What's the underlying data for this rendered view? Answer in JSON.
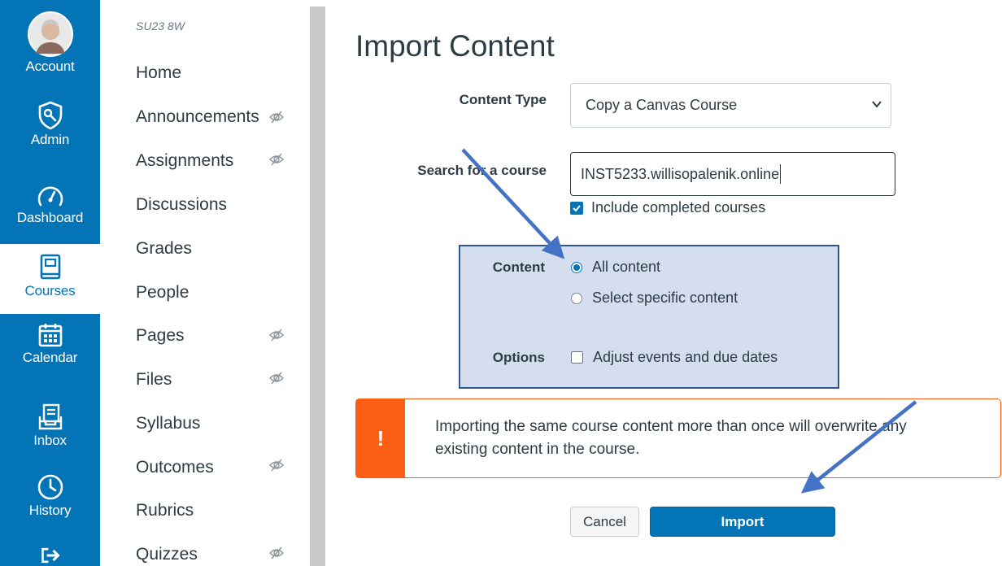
{
  "global_nav": {
    "items": [
      {
        "label": "Account",
        "icon": "avatar"
      },
      {
        "label": "Admin",
        "icon": "shield-icon"
      },
      {
        "label": "Dashboard",
        "icon": "speedometer-icon"
      },
      {
        "label": "Courses",
        "icon": "book-icon"
      },
      {
        "label": "Calendar",
        "icon": "calendar-icon"
      },
      {
        "label": "Inbox",
        "icon": "inbox-icon"
      },
      {
        "label": "History",
        "icon": "clock-icon"
      },
      {
        "label": "",
        "icon": "logout-icon"
      }
    ],
    "active": "Courses",
    "colors": {
      "brand": "#0374b5",
      "active_bg": "#ffffff"
    }
  },
  "course_nav": {
    "term": "SU23 8W",
    "items": [
      {
        "label": "Home",
        "hidden": false
      },
      {
        "label": "Announcements",
        "hidden": true
      },
      {
        "label": "Assignments",
        "hidden": true
      },
      {
        "label": "Discussions",
        "hidden": false
      },
      {
        "label": "Grades",
        "hidden": false
      },
      {
        "label": "People",
        "hidden": false
      },
      {
        "label": "Pages",
        "hidden": true
      },
      {
        "label": "Files",
        "hidden": true
      },
      {
        "label": "Syllabus",
        "hidden": false
      },
      {
        "label": "Outcomes",
        "hidden": true
      },
      {
        "label": "Rubrics",
        "hidden": false
      },
      {
        "label": "Quizzes",
        "hidden": true
      }
    ]
  },
  "main": {
    "title": "Import Content",
    "content_type": {
      "label": "Content Type",
      "value": "Copy a Canvas Course"
    },
    "search": {
      "label": "Search for a course",
      "value": "INST5233.willisopalenik.online"
    },
    "include_completed": {
      "label": "Include completed courses",
      "checked": true
    },
    "content": {
      "label": "Content",
      "options": [
        {
          "label": "All content",
          "selected": true
        },
        {
          "label": "Select specific content",
          "selected": false
        }
      ]
    },
    "options": {
      "label": "Options",
      "adjust_dates": {
        "label": "Adjust events and due dates",
        "checked": false
      }
    },
    "warning": {
      "icon": "!",
      "text": "Importing the same course content more than once will overwrite any existing content in the course."
    },
    "buttons": {
      "cancel": "Cancel",
      "import": "Import"
    },
    "colors": {
      "warning": "#fc5e13",
      "highlight_box": "#d5deef",
      "highlight_border": "#2f5597",
      "annotation_arrow": "#4472c4"
    }
  }
}
